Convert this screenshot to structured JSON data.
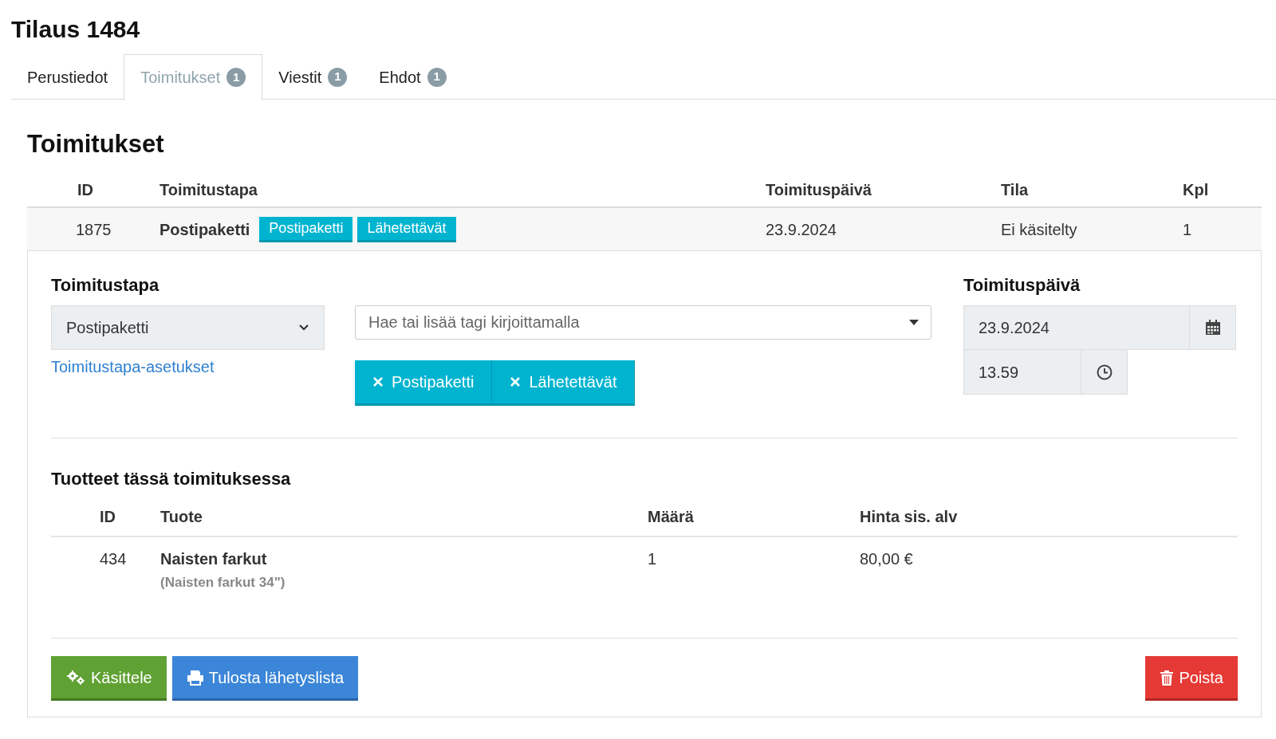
{
  "page_title": "Tilaus 1484",
  "tabs": [
    {
      "label": "Perustiedot",
      "selected": false
    },
    {
      "label": "Toimitukset",
      "badge": "1",
      "selected": true
    },
    {
      "label": "Viestit",
      "badge": "1",
      "selected": false
    },
    {
      "label": "Ehdot",
      "badge": "1",
      "selected": false
    }
  ],
  "section_title": "Toimitukset",
  "deliveries": {
    "columns": [
      "ID",
      "Toimitustapa",
      "Toimituspäivä",
      "Tila",
      "Kpl"
    ],
    "rows": [
      {
        "id": "1875",
        "method": "Postipaketti",
        "tags": [
          "Postipaketti",
          "Lähetettävät"
        ],
        "date": "23.9.2024",
        "status": "Ei käsitelty",
        "count": "1"
      }
    ]
  },
  "detail": {
    "method_label": "Toimitustapa",
    "method_value": "Postipaketti",
    "method_link": "Toimitustapa-asetukset",
    "tag_placeholder": "Hae tai lisää tagi kirjoittamalla",
    "selected_tags": [
      "Postipaketti",
      "Lähetettävät"
    ],
    "date_label": "Toimituspäivä",
    "date_value": "23.9.2024",
    "time_value": "13.59",
    "products_title": "Tuotteet tässä toimituksessa",
    "products": {
      "columns": [
        "ID",
        "Tuote",
        "Määrä",
        "Hinta sis. alv"
      ],
      "rows": [
        {
          "id": "434",
          "name": "Naisten farkut",
          "variant": "(Naisten farkut 34\")",
          "quantity": "1",
          "price": "80,00 €"
        }
      ]
    },
    "buttons": [
      {
        "kind": "process",
        "label": "Käsittele"
      },
      {
        "kind": "print",
        "label": "Tulosta lähetyslista"
      },
      {
        "kind": "delete",
        "label": "Poista"
      }
    ]
  }
}
